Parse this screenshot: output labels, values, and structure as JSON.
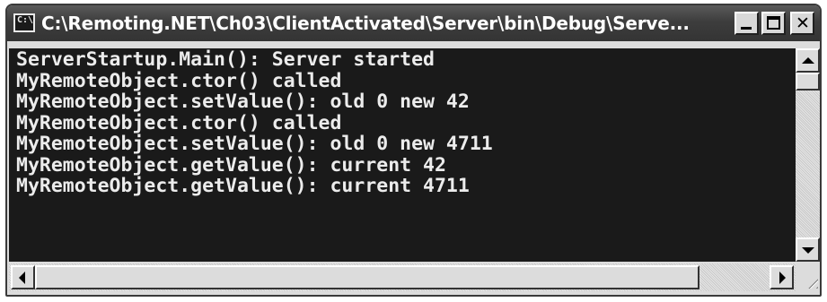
{
  "window": {
    "title": "C:\\Remoting.NET\\Ch03\\ClientActivated\\Server\\bin\\Debug\\Serve...",
    "icon": "command-prompt-icon",
    "icon_text": "C:\\",
    "controls": {
      "minimize": "minimize-icon",
      "maximize": "maximize-icon",
      "close_glyph": "✕"
    }
  },
  "console": {
    "background": "#1a1a1a",
    "foreground": "#ececec",
    "lines": [
      "ServerStartup.Main(): Server started",
      "MyRemoteObject.ctor() called",
      "MyRemoteObject.setValue(): old 0 new 42",
      "MyRemoteObject.ctor() called",
      "MyRemoteObject.setValue(): old 0 new 4711",
      "MyRemoteObject.getValue(): current 42",
      "MyRemoteObject.getValue(): current 4711"
    ]
  },
  "scrollbars": {
    "vertical": {
      "up_icon": "arrow-up-icon",
      "down_icon": "arrow-down-icon"
    },
    "horizontal": {
      "left_icon": "arrow-left-icon",
      "right_icon": "arrow-right-icon"
    }
  }
}
